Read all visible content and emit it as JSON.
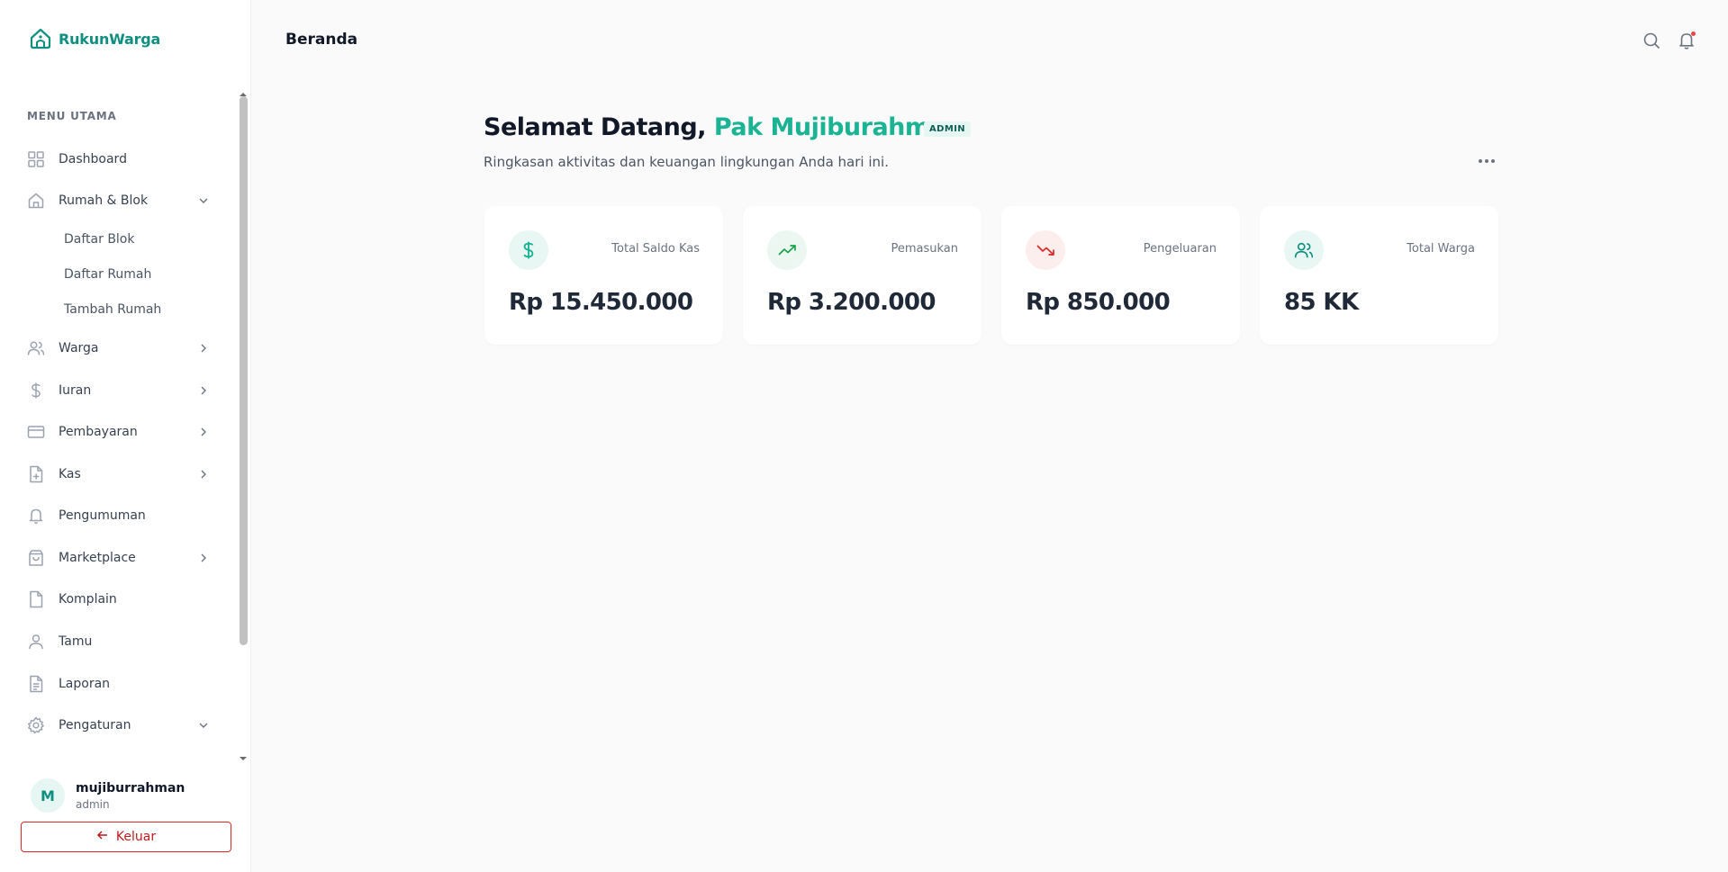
{
  "brand": {
    "name": "RukunWarga",
    "color": "#0f8f80"
  },
  "sidebar": {
    "menu_title": "MENU UTAMA",
    "items": [
      {
        "label": "Dashboard",
        "icon": "grid-icon"
      },
      {
        "label": "Rumah & Blok",
        "icon": "home-icon",
        "expanded": true
      },
      {
        "label": "Warga",
        "icon": "users-icon"
      },
      {
        "label": "Iuran",
        "icon": "dollar-icon"
      },
      {
        "label": "Pembayaran",
        "icon": "credit-card-icon"
      },
      {
        "label": "Kas",
        "icon": "file-plus-icon"
      },
      {
        "label": "Pengumuman",
        "icon": "bell-icon"
      },
      {
        "label": "Marketplace",
        "icon": "shopping-bag-icon"
      },
      {
        "label": "Komplain",
        "icon": "file-icon"
      },
      {
        "label": "Tamu",
        "icon": "user-icon"
      },
      {
        "label": "Laporan",
        "icon": "file-text-icon"
      },
      {
        "label": "Pengaturan",
        "icon": "settings-icon",
        "expanded": true
      }
    ],
    "subitems": [
      "Daftar Blok",
      "Daftar Rumah",
      "Tambah Rumah"
    ]
  },
  "user": {
    "initial": "M",
    "name": "mujiburrahman",
    "role": "admin"
  },
  "logout_label": "Keluar",
  "header": {
    "title": "Beranda"
  },
  "welcome": {
    "greeting": "Selamat Datang, ",
    "name": "Pak Mujiburahman",
    "badge": "ADMIN",
    "subtitle": "Ringkasan aktivitas dan keuangan lingkungan Anda hari ini."
  },
  "cards": [
    {
      "label": "Total Saldo Kas",
      "value": "Rp 15.450.000",
      "icon": "dollar-icon",
      "color": "#1ab394"
    },
    {
      "label": "Pemasukan",
      "value": "Rp 3.200.000",
      "icon": "trending-up-icon",
      "color": "#16a34a"
    },
    {
      "label": "Pengeluaran",
      "value": "Rp 850.000",
      "icon": "trending-down-icon",
      "color": "#dc2626"
    },
    {
      "label": "Total Warga",
      "value": "85 KK",
      "icon": "users-icon",
      "color": "#0f8f80"
    }
  ],
  "colors": {
    "accent": "#1ab394",
    "danger": "#dc2626",
    "background": "#fafafa"
  }
}
